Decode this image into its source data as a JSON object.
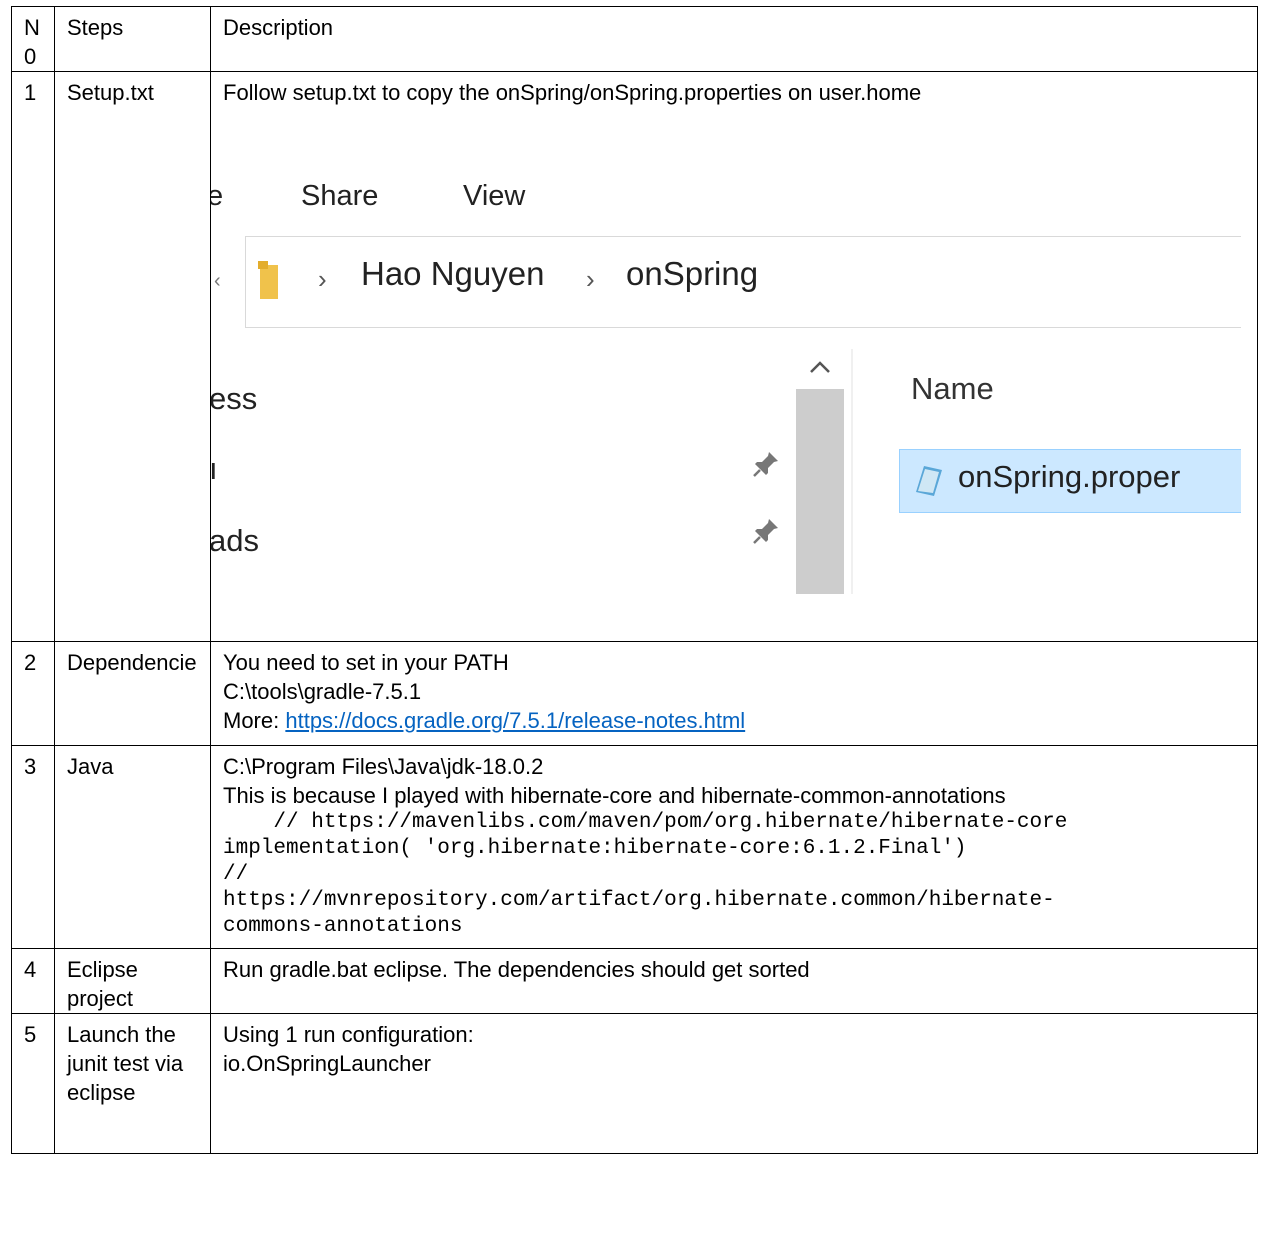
{
  "header": {
    "no": "N\n0",
    "steps": "Steps",
    "description": "Description"
  },
  "rows": [
    {
      "no": "1",
      "step": "Setup.txt",
      "lines": [
        "Follow setup.txt to copy the onSpring/onSpring.properties on user.home"
      ],
      "explorer": {
        "ribbon_partial": "e",
        "ribbon_share": "Share",
        "ribbon_view": "View",
        "crumb_1": "Hao Nguyen",
        "crumb_2": "onSpring",
        "nav_partial_1": "ess",
        "nav_partial_2": "ı",
        "nav_partial_3": "ads",
        "column_name": "Name",
        "file_name": "onSpring.proper"
      }
    },
    {
      "no": "2",
      "step": "Dependencie",
      "lines": [
        "You need to set in your PATH",
        "C:\\tools\\gradle-7.5.1"
      ],
      "more_label": "More: ",
      "link": "https://docs.gradle.org/7.5.1/release-notes.html"
    },
    {
      "no": "3",
      "step": "Java",
      "lines": [
        "C:\\Program Files\\Java\\jdk-18.0.2",
        "This is because I played with hibernate-core and hibernate-common-annotations"
      ],
      "code": "    // https://mavenlibs.com/maven/pom/org.hibernate/hibernate-core\nimplementation( 'org.hibernate:hibernate-core:6.1.2.Final')\n//\nhttps://mvnrepository.com/artifact/org.hibernate.common/hibernate-\ncommons-annotations"
    },
    {
      "no": "4",
      "step": "Eclipse project",
      "lines": [
        "Run gradle.bat eclipse. The dependencies should get sorted"
      ]
    },
    {
      "no": "5",
      "step": "Launch the junit test via eclipse",
      "lines": [
        "Using 1 run configuration:",
        "io.OnSpringLauncher"
      ]
    }
  ]
}
